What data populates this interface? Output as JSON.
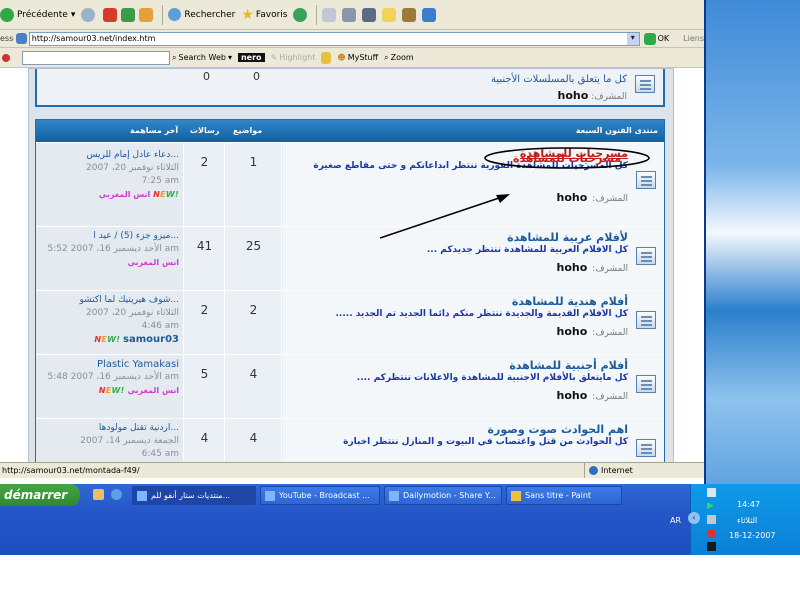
{
  "toolbar": {
    "back_label": "Précédente",
    "search_label": "Rechercher",
    "favorites_label": "Favoris"
  },
  "address": {
    "label": "esse",
    "url": "http://samour03.net/index.htm",
    "go_label": "OK",
    "links_label": "Liens"
  },
  "nero_bar": {
    "search_web_label": "Search Web",
    "nero_label": "nero",
    "highlight_label": "Highlight",
    "mystuff_label": "MyStuff",
    "zoom_label": "Zoom"
  },
  "prev_forum": {
    "count_a": "0",
    "count_b": "0",
    "description": "كل ما يتعلق بالمسلسلات الأجنبية",
    "moderator_label": "المشرف:",
    "moderator": "hoho"
  },
  "category": {
    "title": "منتدى الفنون السبعة",
    "col_topics": "مواضيع",
    "col_posts": "رسالات",
    "col_last": "آخر مساهمة"
  },
  "annotation": {
    "circled_text": "مسرحيات للمشاهدة"
  },
  "forums": [
    {
      "title": "مسرحيات للمشاهدة",
      "description": "كل المسرحيات للمشاهدة الفورية ننتظر ابداعاتكم و حتى مقاطع صغيرة",
      "moderator_label": "المشرف:",
      "moderator": "hoho",
      "topics": "1",
      "posts": "2",
      "last_title": "دعاء عادل إمام للريس...",
      "last_date": "الثلاثاء نوفمبر 20، 2007",
      "last_time": "7:25 am",
      "last_user": "انس المغربي",
      "new_label": "NEW!"
    },
    {
      "title": "لأفلام عربية للمشاهدة",
      "description": "كل الافلام العربية للمشاهدة ننتظر جديدكم ...",
      "moderator_label": "المشرف:",
      "moderator": "hoho",
      "topics": "25",
      "posts": "41",
      "last_title": "ميزو جزء (5) / عيد ا...",
      "last_date": "الأحد ديسمبر 16، 2007",
      "last_time": "5:52 am",
      "last_user": "انس المغربي",
      "new_label": "NEW!"
    },
    {
      "title": "أفلام هندية للمشاهدة",
      "description": "كل الافلام القديمة والجديدة ننتظر منكم دائما الجديد تم الجديد .....",
      "moderator_label": "المشرف:",
      "moderator": "hoho",
      "topics": "2",
      "posts": "2",
      "last_title": "شوف هيريتيك لما اكتشو...",
      "last_date": "الثلاثاء نوفمبر 20، 2007",
      "last_time": "4:46 am",
      "last_user": "samour03",
      "new_label": "NEW!"
    },
    {
      "title": "أفلام أجنبية للمشاهدة",
      "description": "كل مايتعلق بالأفلام الاجنبية للمشاهدة والاعلانات ننتظركم ....",
      "moderator_label": "المشرف:",
      "moderator": "hoho",
      "topics": "4",
      "posts": "5",
      "last_title": "Plastic Yamakasi",
      "last_date": "الأحد ديسمبر 16، 2007",
      "last_time": "5:48 am",
      "last_user": "انس المغربي",
      "new_label": "NEW!"
    },
    {
      "title": "اهم الحوادث صوت وصورة",
      "description": "كل الحوادث من قتل واغتصاب في البيوت و المنازل ننتظر اخبارة",
      "moderator_label": "",
      "moderator": "",
      "topics": "4",
      "posts": "4",
      "last_title": "اردنية تقتل مولودها...",
      "last_date": "الجمعة ديسمبر 14، 2007",
      "last_time": "6:45 am",
      "last_user": "",
      "new_label": ""
    }
  ],
  "statusbar": {
    "url": "http://samour03.net/montada-f49/",
    "zone": "Internet"
  },
  "taskbar": {
    "start_label": "démarrer",
    "tasks": [
      "منتديات ستار أنفو للم...",
      "YouTube - Broadcast ...",
      "Dailymotion - Share Y...",
      "Sans titre - Paint"
    ],
    "lang": "AR",
    "time": "14:47",
    "day": "الثلاثاء",
    "date": "18-12-2007"
  },
  "colors": {
    "category_bar": "#1f6fb0",
    "link_blue": "#1d5a9a",
    "annotation": "#000000",
    "highlight_red": "#d01818"
  }
}
